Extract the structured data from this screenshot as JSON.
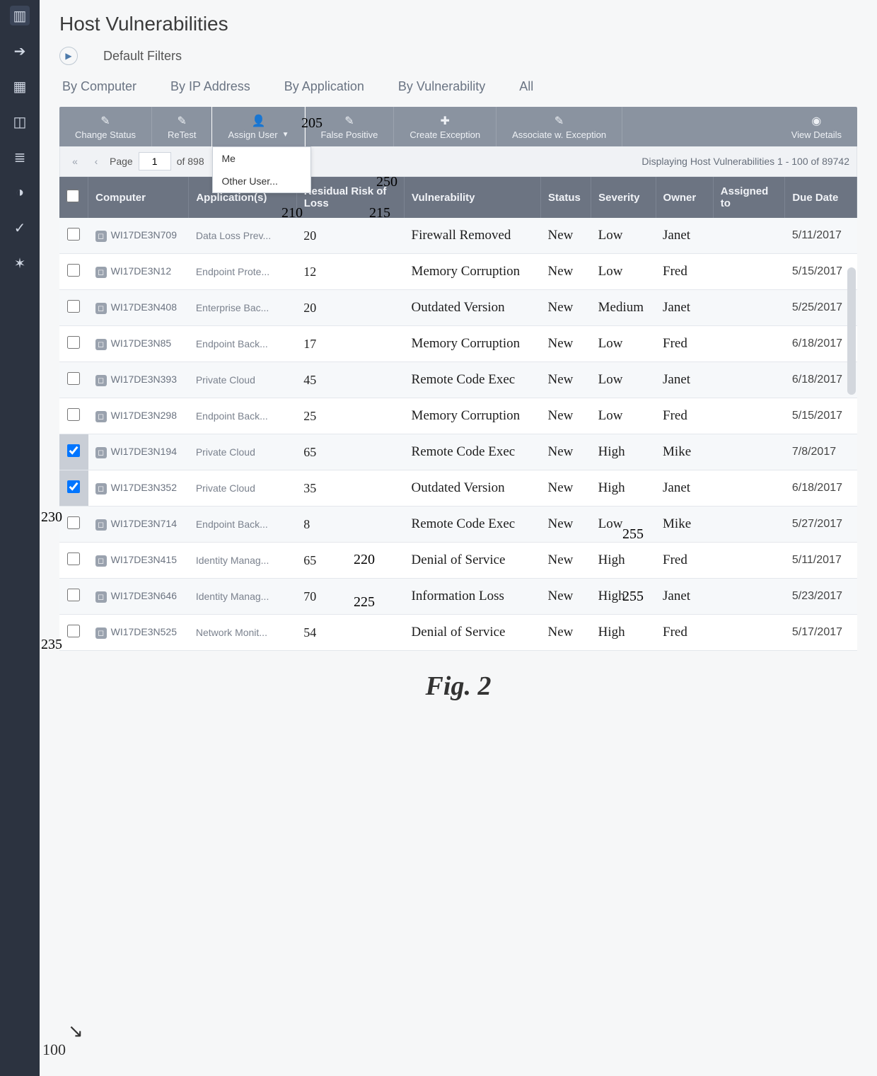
{
  "page": {
    "title": "Host Vulnerabilities",
    "default_filters": "Default Filters",
    "figure": "Fig. 2",
    "foot_ref": "100"
  },
  "rail": [
    {
      "name": "chart-icon",
      "glyph": "▥"
    },
    {
      "name": "arrow-right-icon",
      "glyph": "➔"
    },
    {
      "name": "grid-icon",
      "glyph": "▦"
    },
    {
      "name": "box-icon",
      "glyph": "◫"
    },
    {
      "name": "list-icon",
      "glyph": "≣"
    },
    {
      "name": "tag-icon",
      "glyph": "◑"
    },
    {
      "name": "refresh-icon",
      "glyph": "✓"
    },
    {
      "name": "gear-icon",
      "glyph": "✶"
    }
  ],
  "tabs": [
    {
      "label": "By Computer"
    },
    {
      "label": "By IP Address"
    },
    {
      "label": "By Application"
    },
    {
      "label": "By Vulnerability"
    },
    {
      "label": "All"
    }
  ],
  "toolbar": {
    "change_status": "Change Status",
    "retest": "ReTest",
    "assign_user": "Assign User",
    "false_positive": "False Positive",
    "create_exception": "Create Exception",
    "assoc_exception": "Associate w. Exception",
    "view_details": "View Details"
  },
  "assign_menu": {
    "me": "Me",
    "other": "Other User..."
  },
  "pager": {
    "label_page": "Page",
    "page": "1",
    "label_of": "of 898",
    "summary": "Displaying Host Vulnerabilities 1 - 100 of 89742"
  },
  "columns": {
    "computer": "Computer",
    "applications": "Application(s)",
    "residual": "Residual Risk of Loss",
    "vulnerability": "Vulnerability",
    "status": "Status",
    "severity": "Severity",
    "owner": "Owner",
    "assigned": "Assigned to",
    "due": "Due Date"
  },
  "rows": [
    {
      "cb": false,
      "computer": "WI17DE3N709",
      "application": "Data Loss Prev...",
      "rrl": "20",
      "vuln": "Firewall Removed",
      "status": "New",
      "severity": "Low",
      "owner": "Janet",
      "assigned": "",
      "due": "5/11/2017"
    },
    {
      "cb": false,
      "computer": "WI17DE3N12",
      "application": "Endpoint Prote...",
      "rrl": "12",
      "vuln": "Memory Corruption",
      "status": "New",
      "severity": "Low",
      "owner": "Fred",
      "assigned": "",
      "due": "5/15/2017"
    },
    {
      "cb": false,
      "computer": "WI17DE3N408",
      "application": "Enterprise Bac...",
      "rrl": "20",
      "vuln": "Outdated Version",
      "status": "New",
      "severity": "Medium",
      "owner": "Janet",
      "assigned": "",
      "due": "5/25/2017"
    },
    {
      "cb": false,
      "computer": "WI17DE3N85",
      "application": "Endpoint Back...",
      "rrl": "17",
      "vuln": "Memory Corruption",
      "status": "New",
      "severity": "Low",
      "owner": "Fred",
      "assigned": "",
      "due": "6/18/2017"
    },
    {
      "cb": false,
      "computer": "WI17DE3N393",
      "application": "Private Cloud",
      "rrl": "45",
      "vuln": "Remote Code Exec",
      "status": "New",
      "severity": "Low",
      "owner": "Janet",
      "assigned": "",
      "due": "6/18/2017"
    },
    {
      "cb": false,
      "computer": "WI17DE3N298",
      "application": "Endpoint Back...",
      "rrl": "25",
      "vuln": "Memory Corruption",
      "status": "New",
      "severity": "Low",
      "owner": "Fred",
      "assigned": "",
      "due": "5/15/2017"
    },
    {
      "cb": true,
      "computer": "WI17DE3N194",
      "application": "Private Cloud",
      "rrl": "65",
      "vuln": "Remote Code Exec",
      "status": "New",
      "severity": "High",
      "owner": "Mike",
      "assigned": "",
      "due": "7/8/2017"
    },
    {
      "cb": true,
      "computer": "WI17DE3N352",
      "application": "Private Cloud",
      "rrl": "35",
      "vuln": "Outdated Version",
      "status": "New",
      "severity": "High",
      "owner": "Janet",
      "assigned": "",
      "due": "6/18/2017"
    },
    {
      "cb": false,
      "computer": "WI17DE3N714",
      "application": "Endpoint Back...",
      "rrl": "8",
      "vuln": "Remote Code Exec",
      "status": "New",
      "severity": "Low",
      "owner": "Mike",
      "assigned": "",
      "due": "5/27/2017"
    },
    {
      "cb": false,
      "computer": "WI17DE3N415",
      "application": "Identity Manag...",
      "rrl": "65",
      "vuln": "Denial of Service",
      "status": "New",
      "severity": "High",
      "owner": "Fred",
      "assigned": "",
      "due": "5/11/2017"
    },
    {
      "cb": false,
      "computer": "WI17DE3N646",
      "application": "Identity Manag...",
      "rrl": "70",
      "vuln": "Information Loss",
      "status": "New",
      "severity": "High",
      "owner": "Janet",
      "assigned": "",
      "due": "5/23/2017"
    },
    {
      "cb": false,
      "computer": "WI17DE3N525",
      "application": "Network Monit...",
      "rrl": "54",
      "vuln": "Denial of Service",
      "status": "New",
      "severity": "High",
      "owner": "Fred",
      "assigned": "",
      "due": "5/17/2017"
    }
  ],
  "callouts": {
    "c205": "205",
    "c210": "210",
    "c215": "215",
    "c220": "220",
    "c225": "225",
    "c230": "230",
    "c235": "235",
    "c250": "250",
    "c255a": "255",
    "c255b": "255"
  }
}
